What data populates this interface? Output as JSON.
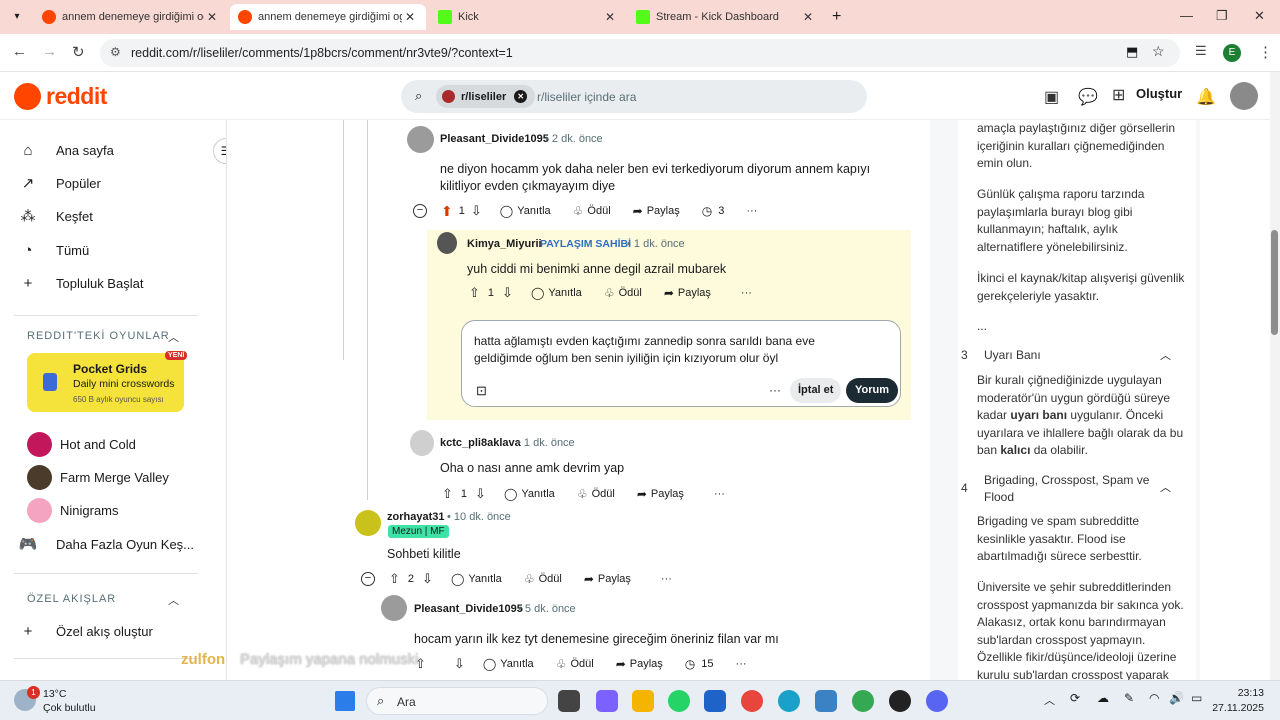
{
  "browser": {
    "tabs": [
      {
        "title": "annem denemeye girdiğimi og",
        "icon": "reddit-icon",
        "active": false
      },
      {
        "title": "annem denemeye girdiğimi og",
        "icon": "reddit-icon",
        "active": true
      },
      {
        "title": "Kick",
        "icon": "kick-icon",
        "active": false
      },
      {
        "title": "Stream - Kick Dashboard",
        "icon": "kick-icon",
        "active": false
      }
    ],
    "url": "reddit.com/r/liseliler/comments/1p8bcrs/comment/nr3vte9/?context=1",
    "profile_initial": "E"
  },
  "header": {
    "logo": "reddit",
    "search_chip": "r/liseliler",
    "search_placeholder": "r/liseliler içinde ara",
    "create_label": "Oluştur"
  },
  "sidebar": {
    "nav": [
      {
        "label": "Ana sayfa",
        "icon": "home-icon"
      },
      {
        "label": "Popüler",
        "icon": "popular-icon"
      },
      {
        "label": "Keşfet",
        "icon": "explore-icon"
      },
      {
        "label": "Tümü",
        "icon": "all-icon"
      },
      {
        "label": "Topluluk Başlat",
        "icon": "plus-icon"
      }
    ],
    "games_header": "REDDIT'TEKİ OYUNLAR",
    "pocket_grids": {
      "title": "Pocket Grids",
      "subtitle": "Daily mini crosswords",
      "users": "650 B aylık oyuncu sayısı",
      "badge": "YENİ"
    },
    "games": [
      {
        "label": "Hot and Cold",
        "icon": "hot-and-cold-icon",
        "color": "#c2185b"
      },
      {
        "label": "Farm Merge Valley",
        "icon": "farm-merge-valley-icon",
        "color": "#4a3b2b"
      },
      {
        "label": "Ninigrams",
        "icon": "ninigrams-icon",
        "color": "#f4a4c0"
      },
      {
        "label": "Daha Fazla Oyun Keş...",
        "icon": "gamepad-icon",
        "color": "#ffffff"
      }
    ],
    "feeds_header": "ÖZEL AKIŞLAR",
    "create_feed": "Özel akış oluştur"
  },
  "comments": [
    {
      "user": "Pleasant_Divide1095",
      "time": "2 dk. önce",
      "body": "ne diyon hocamm yok daha neler ben evi terkediyorum diyorum annem kapıyı kilitliyor evden çıkmayayım diye",
      "votes": "1",
      "reply": "Yanıtla",
      "award": "Ödül",
      "share": "Paylaş",
      "replies": "3"
    },
    {
      "user": "Kimya_Miyurii",
      "flair_op": "PAYLAŞIM SAHİBİ",
      "time": "1 dk. önce",
      "body": "yuh ciddi mi benimki anne degil azrail mubarek",
      "votes": "1",
      "reply": "Yanıtla",
      "award": "Ödül",
      "share": "Paylaş"
    },
    {
      "user": "kctc_pli8aklava",
      "time": "1 dk. önce",
      "body": "Oha o nası anne amk devrim yap",
      "votes": "1",
      "reply": "Yanıtla",
      "award": "Ödül",
      "share": "Paylaş"
    },
    {
      "user": "zorhayat31",
      "flair": "Mezun | MF",
      "time": "10 dk. önce",
      "body": "Sohbeti kilitle",
      "votes": "2",
      "reply": "Yanıtla",
      "award": "Ödül",
      "share": "Paylaş"
    },
    {
      "user": "Pleasant_Divide1095",
      "time": "5 dk. önce",
      "body": "hocam yarın ilk kez tyt denemesine gireceğim öneriniz filan var mı",
      "votes": "",
      "reply": "Yanıtla",
      "award": "Ödül",
      "share": "Paylaş",
      "replies": "15"
    }
  ],
  "reply_box": {
    "text": "hatta ağlamıştı evden kaçtığımı zannedip sonra sarıldı bana eve geldiğimde oğlum ben senin iyiliğin için kızıyorum olur öyl",
    "cancel": "İptal et",
    "submit": "Yorum"
  },
  "overlay_text": {
    "brand": "zulfon",
    "caption": "Paylaşım yapana nolmuski"
  },
  "rules": {
    "intro_1": "amaçla paylaştığınız diğer görsellerin içeriğinin kuralları çiğnemediğinden emin olun.",
    "intro_2": "Günlük çalışma raporu tarzında paylaşımlarla burayı blog gibi kullanmayın; haftalık, aylık alternatiflere yönelebilirsiniz.",
    "intro_3": "İkinci el kaynak/kitap alışverişi güvenlik gerekçeleriyle yasaktır.",
    "ellipsis": "...",
    "rule3_num": "3",
    "rule3_title": "Uyarı Banı",
    "rule3_p1": "Bir kuralı çiğnediğinizde uygulayan moderatör'ün uygun gördüğü süreye kadar",
    "rule3_bold1": "uyarı banı",
    "rule3_p2": "uygulanır. Önceki uyarılara ve ihlallere bağlı olarak da bu ban",
    "rule3_bold2": "kalıcı",
    "rule3_p3": "da olabilir.",
    "rule4_num": "4",
    "rule4_title": "Brigading, Crosspost, Spam ve Flood",
    "rule4_p1": "Brigading ve spam subredditte kesinlikle yasaktır. Flood ise abartılmadığı sürece serbesttir.",
    "rule4_p2": "Üniversite ve şehir subredditlerinden crosspost yapmanızda bir sakınca yok. Alakasız, ortak konu barındırmayan sub'lardan crosspost yapmayın. Özellikle fikir/düşünce/ideoloji üzerine kurulu sub'lardan crosspost yaparak"
  },
  "taskbar": {
    "weather_temp": "13°C",
    "weather_desc": "Çok bulutlu",
    "weather_badge": "1",
    "search_label": "Ara",
    "time": "23:13",
    "date": "27.11.2025"
  }
}
